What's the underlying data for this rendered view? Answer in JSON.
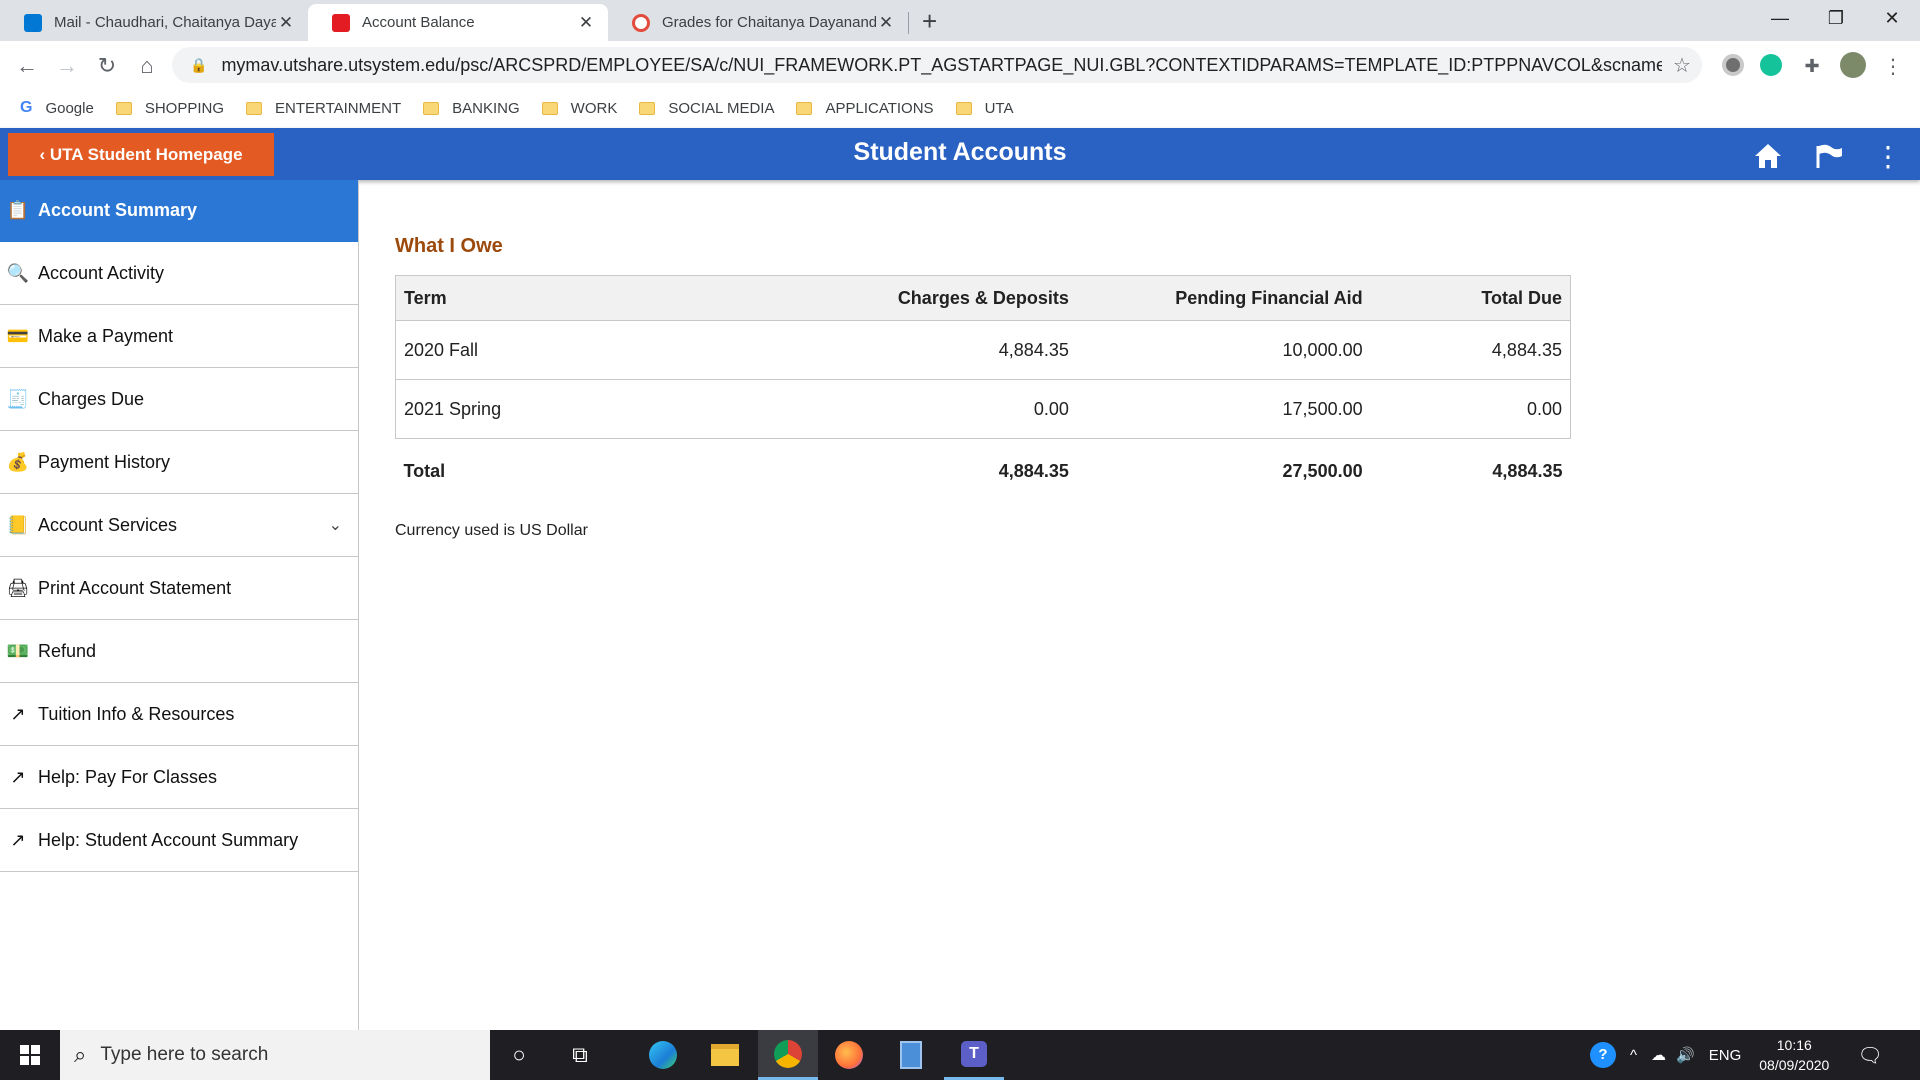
{
  "browser": {
    "tabs": [
      {
        "title": "Mail - Chaudhari, Chaitanya Dayanand - Outlook",
        "display": "Mail - Chaudhari, Chaitanya Daya",
        "favicon_color": "#0078d4",
        "active": false
      },
      {
        "title": "Account Balance",
        "display": "Account Balance",
        "favicon_color": "#e31b23",
        "active": true
      },
      {
        "title": "Grades for Chaitanya Dayanand",
        "display": "Grades for Chaitanya Dayanand (",
        "favicon_color": "#e34c3c",
        "active": false
      }
    ],
    "url": "mymav.utshare.utsystem.edu/psc/ARCSPRD/EMPLOYEE/SA/c/NUI_FRAMEWORK.PT_AGSTARTPAGE_NUI.GBL?CONTEXTIDPARAMS=TEMPLATE_ID:PTPPNAVCOL&scname=UTA_STUDENT_...",
    "bookmarks": [
      "Google",
      "SHOPPING",
      "ENTERTAINMENT",
      "BANKING",
      "WORK",
      "SOCIAL MEDIA",
      "APPLICATIONS",
      "UTA"
    ]
  },
  "header": {
    "back_label": "‹ UTA Student Homepage",
    "title": "Student Accounts",
    "accent_color": "#2a62c4",
    "button_color": "#e35a23"
  },
  "sidebar": {
    "items": [
      {
        "label": "Account Summary",
        "icon": "summary-icon",
        "active": true
      },
      {
        "label": "Account Activity",
        "icon": "activity-icon"
      },
      {
        "label": "Make a Payment",
        "icon": "payment-icon"
      },
      {
        "label": "Charges Due",
        "icon": "charges-icon"
      },
      {
        "label": "Payment History",
        "icon": "history-icon"
      },
      {
        "label": "Account Services",
        "icon": "services-icon",
        "expandable": true
      },
      {
        "label": "Print Account Statement",
        "icon": "printer-icon"
      },
      {
        "label": "Refund",
        "icon": "refund-icon"
      },
      {
        "label": "Tuition Info & Resources",
        "icon": "external-link-icon"
      },
      {
        "label": "Help: Pay For Classes",
        "icon": "external-link-icon"
      },
      {
        "label": "Help: Student Account Summary",
        "icon": "external-link-icon"
      }
    ]
  },
  "main": {
    "section_title": "What I Owe",
    "table": {
      "headers": [
        "Term",
        "Charges & Deposits",
        "Pending Financial Aid",
        "Total Due"
      ],
      "rows": [
        [
          "2020 Fall",
          "4,884.35",
          "10,000.00",
          "4,884.35"
        ],
        [
          "2021 Spring",
          "0.00",
          "17,500.00",
          "0.00"
        ]
      ],
      "total": [
        "Total",
        "4,884.35",
        "27,500.00",
        "4,884.35"
      ]
    },
    "currency_note": "Currency used is US Dollar"
  },
  "taskbar": {
    "search_placeholder": "Type here to search",
    "language": "ENG",
    "time": "10:16",
    "date": "08/09/2020"
  }
}
